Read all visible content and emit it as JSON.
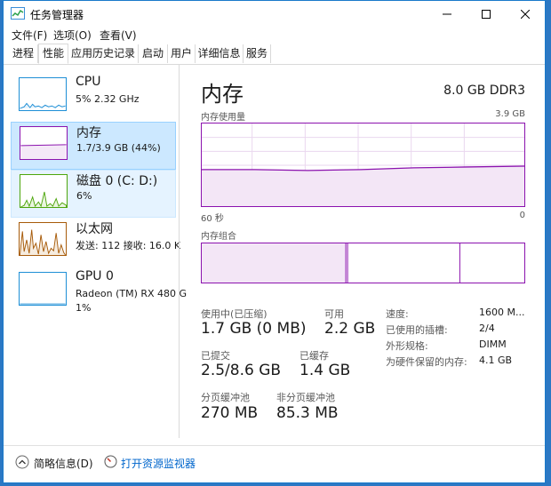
{
  "window": {
    "title": "任务管理器"
  },
  "menu": [
    "文件(F)",
    "选项(O)",
    "查看(V)"
  ],
  "tabs": [
    "进程",
    "性能",
    "应用历史记录",
    "启动",
    "用户",
    "详细信息",
    "服务"
  ],
  "sidebar": [
    {
      "name": "CPU",
      "sub": "5%  2.32 GHz"
    },
    {
      "name": "内存",
      "sub": "1.7/3.9 GB (44%)"
    },
    {
      "name": "磁盘 0 (C: D:)",
      "sub": "6%"
    },
    {
      "name": "以太网",
      "sub": "发送: 112  接收: 16.0 K"
    },
    {
      "name": "GPU 0",
      "sub": "Radeon (TM) RX 480 G",
      "sub2": "1%"
    }
  ],
  "main": {
    "title": "内存",
    "spec": "8.0 GB DDR3",
    "usage_label": "内存使用量",
    "usage_max": "3.9 GB",
    "time_left": "60 秒",
    "time_right": "0",
    "composition_label": "内存组合",
    "in_use_label": "使用中(已压缩)",
    "in_use_value": "1.7 GB (0 MB)",
    "available_label": "可用",
    "available_value": "2.2 GB",
    "committed_label": "已提交",
    "committed_value": "2.5/8.6 GB",
    "cached_label": "已缓存",
    "cached_value": "1.4 GB",
    "paged_label": "分页缓冲池",
    "paged_value": "270 MB",
    "nonpaged_label": "非分页缓冲池",
    "nonpaged_value": "85.3 MB",
    "specs": [
      {
        "label": "速度:",
        "value": "1600 M..."
      },
      {
        "label": "已使用的插槽:",
        "value": "2/4"
      },
      {
        "label": "外形规格:",
        "value": "DIMM"
      },
      {
        "label": "为硬件保留的内存:",
        "value": "4.1 GB"
      }
    ]
  },
  "footer": {
    "less_details": "简略信息(D)",
    "open_monitor": "打开资源监视器"
  },
  "colors": {
    "accent": "#8b12ae",
    "cpu": "#1e8fd6",
    "disk": "#4da60c",
    "net": "#a75b0a",
    "gpu": "#1e8fd6",
    "selected": "#cce8ff"
  }
}
